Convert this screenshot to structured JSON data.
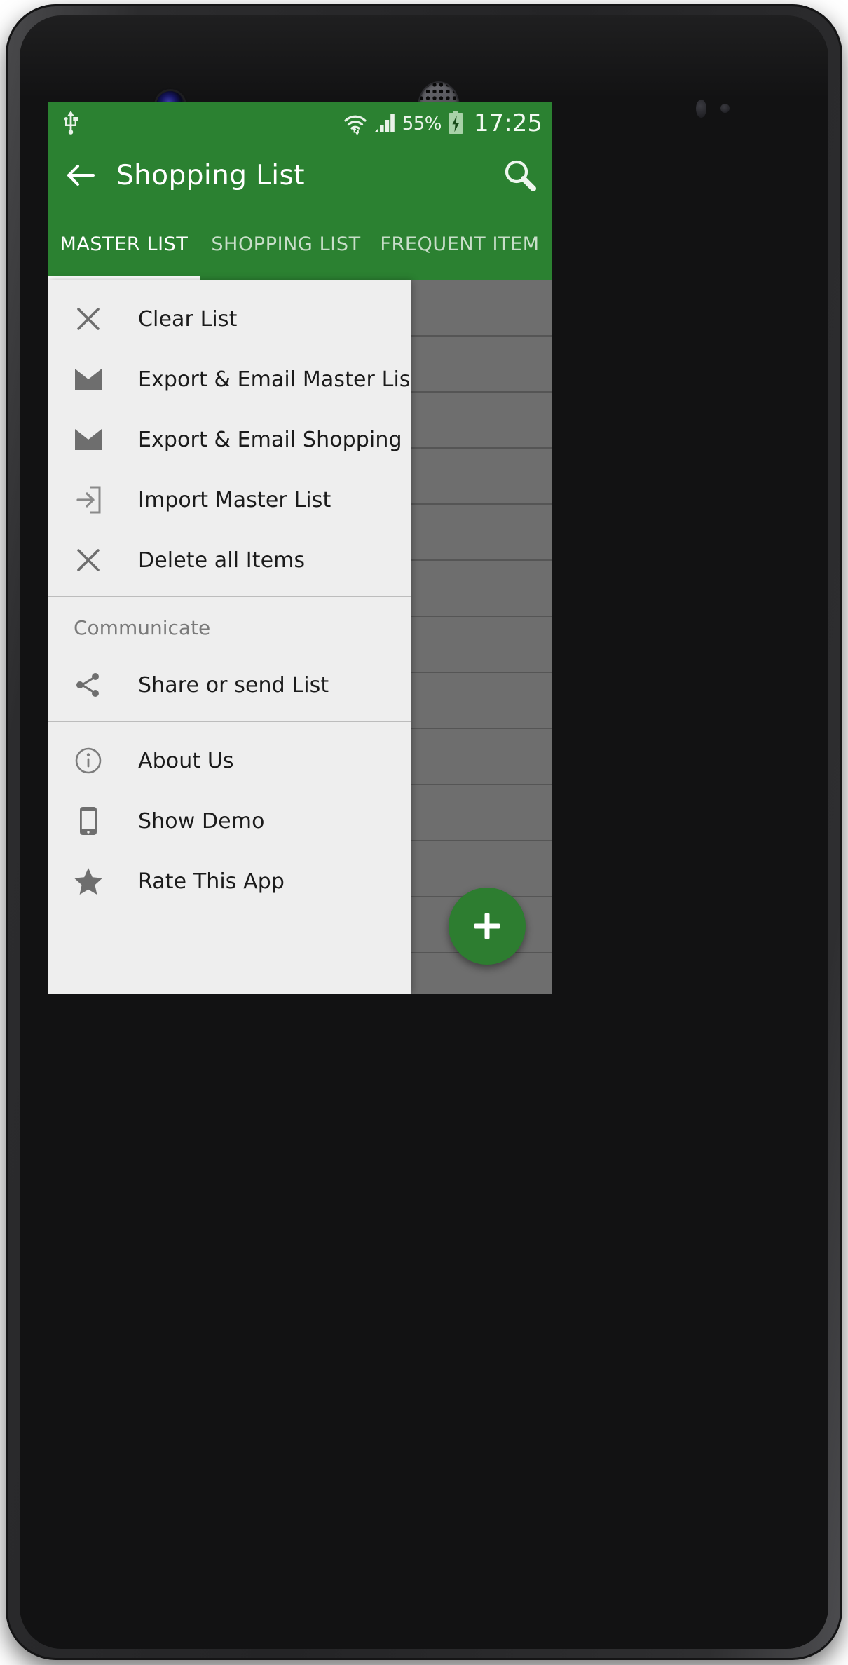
{
  "device": {
    "hardware": {
      "front_camera": "front-camera",
      "earpiece": "earpiece-speaker",
      "proximity_sensor": "proximity-sensor",
      "light_sensor": "light-sensor"
    }
  },
  "status_bar": {
    "usb_icon": "usb-icon",
    "wifi_icon": "wifi-icon",
    "signal_icon": "signal-bars-icon",
    "battery_percent": "55%",
    "battery_icon": "battery-charging-icon",
    "clock": "17:25",
    "background_color": "#2b8131",
    "text_color": "#eef5ee"
  },
  "app_bar": {
    "back_icon": "arrow-left-icon",
    "title": "Shopping List",
    "search_icon": "search-icon",
    "background_color": "#2b8131",
    "title_color": "#ffffff"
  },
  "tabs": {
    "active_index": 0,
    "indicator_color": "#ffffff",
    "items": [
      {
        "label": "MASTER LIST",
        "active": true
      },
      {
        "label": "SHOPPING LIST",
        "active": false
      },
      {
        "label": "FREQUENT ITEM",
        "active": false
      }
    ]
  },
  "fab": {
    "icon": "plus-icon",
    "color": "#2d7d30",
    "icon_color": "#ffffff"
  },
  "overflow_menu": {
    "background_color": "#eeeeee",
    "label_color": "#1b1b1b",
    "icon_color": "#6e6e6e",
    "groups": [
      {
        "header": null,
        "items": [
          {
            "label": "Clear List",
            "icon": "close-x-icon"
          },
          {
            "label": "Export & Email Master List",
            "icon": "envelope-icon"
          },
          {
            "label": "Export & Email Shopping List",
            "icon": "envelope-icon"
          },
          {
            "label": "Import Master List",
            "icon": "import-arrow-icon"
          },
          {
            "label": "Delete all Items",
            "icon": "close-x-icon"
          }
        ]
      },
      {
        "header": "Communicate",
        "items": [
          {
            "label": "Share or send List",
            "icon": "share-icon"
          }
        ]
      },
      {
        "header": null,
        "items": [
          {
            "label": "About Us",
            "icon": "info-circle-icon"
          },
          {
            "label": "Show Demo",
            "icon": "smartphone-icon"
          },
          {
            "label": "Rate This App",
            "icon": "star-icon"
          }
        ]
      }
    ]
  },
  "background_list": {
    "row_color": "#6e6e6e",
    "divider_color": "#555555",
    "row_count": 12
  }
}
